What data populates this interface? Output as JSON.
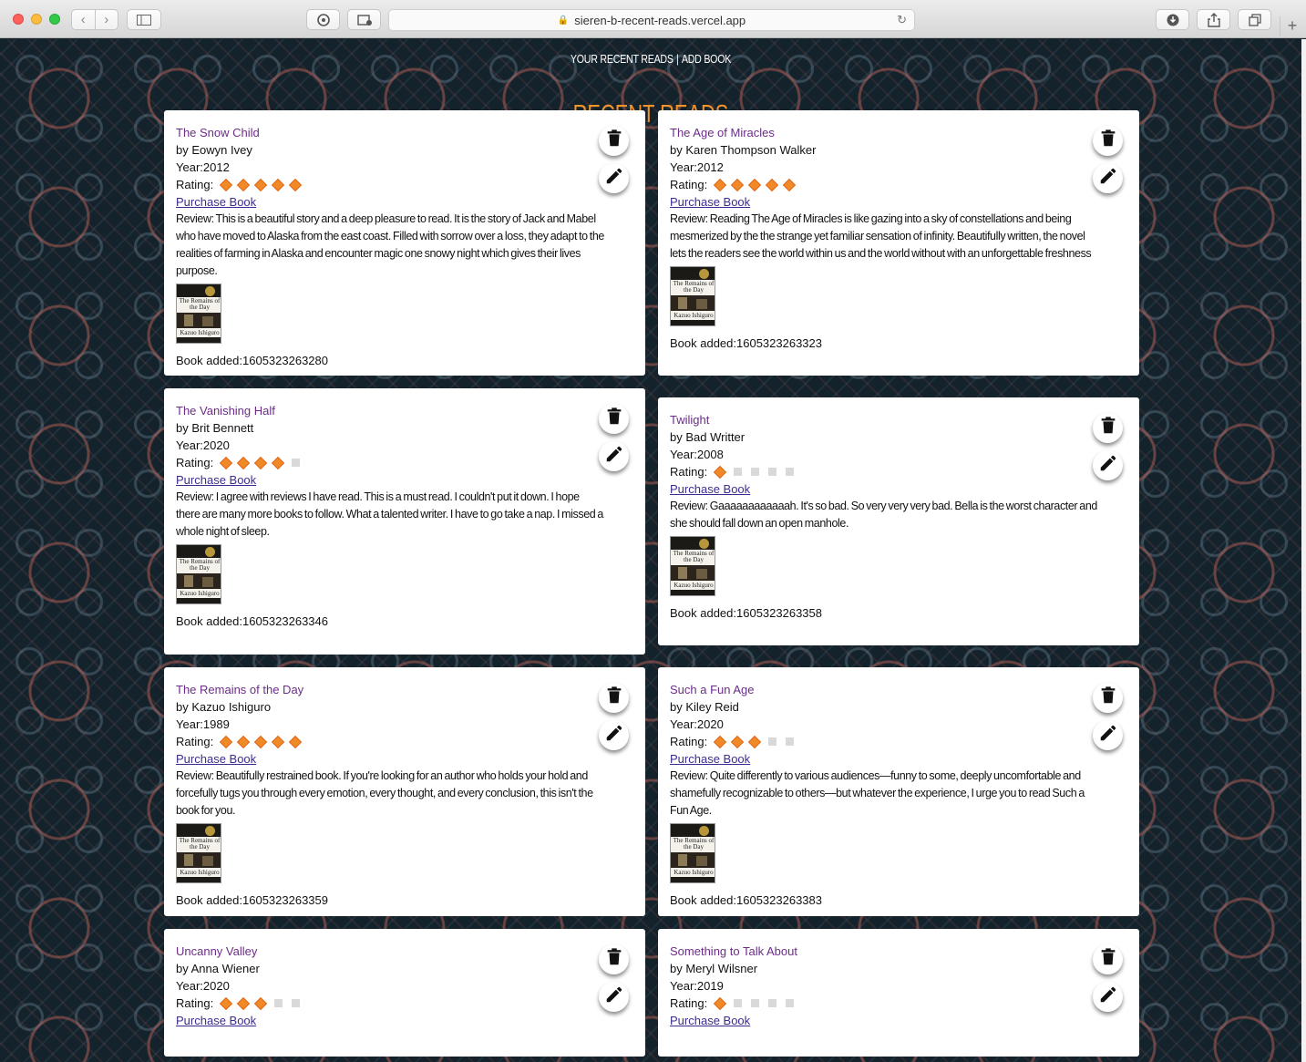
{
  "browser": {
    "url": "sieren-b-recent-reads.vercel.app"
  },
  "nav": {
    "recent_label": "YOUR RECENT READS",
    "separator": "|",
    "add_label": "ADD BOOK"
  },
  "page": {
    "title": "RECENT READS"
  },
  "labels": {
    "rating": "Rating:",
    "purchase": "Purchase Book"
  },
  "books": [
    {
      "title": "The Snow Child",
      "author": "by Eowyn Ivey",
      "year": "Year:2012",
      "rating": 5,
      "review": "Review: This is a beautiful story and a deep pleasure to read. It is the story of Jack and Mabel who have moved to Alaska from the east coast. Filled with sorrow over a loss, they adapt to the realities of farming in Alaska and encounter magic one snowy night which gives their lives purpose.",
      "added": "Book added:1605323263280"
    },
    {
      "title": "The Age of Miracles",
      "author": "by Karen Thompson Walker",
      "year": "Year:2012",
      "rating": 5,
      "review": "Review: Reading The Age of Miracles is like gazing into a sky of constellations and being mesmerized by the the strange yet familiar sensation of infinity. Beautifully written, the novel lets the readers see the world within us and the world without with an unforgettable freshness",
      "added": "Book added:1605323263323"
    },
    {
      "title": "The Vanishing Half",
      "author": "by Brit Bennett",
      "year": "Year:2020",
      "rating": 4,
      "review": "Review: I agree with reviews I have read. This is a must read. I couldn't put it down. I hope there are many more books to follow. What a talented writer. I have to go take a nap. I missed a whole night of sleep.",
      "added": "Book added:1605323263346"
    },
    {
      "title": "Twilight",
      "author": "by Bad Writter",
      "year": "Year:2008",
      "rating": 1,
      "review": "Review: Gaaaaaaaaaaaah. It's so bad. So very very very bad. Bella is the worst character and she should fall down an open manhole.",
      "added": "Book added:1605323263358"
    },
    {
      "title": "The Remains of the Day",
      "author": "by Kazuo Ishiguro",
      "year": "Year:1989",
      "rating": 5,
      "review": "Review: Beautifully restrained book. If you're looking for an author who holds your hold and forcefully tugs you through every emotion, every thought, and every conclusion, this isn't the book for you.",
      "added": "Book added:1605323263359"
    },
    {
      "title": "Such a Fun Age",
      "author": "by Kiley Reid",
      "year": "Year:2020",
      "rating": 3,
      "review": "Review: Quite differently to various audiences—funny to some, deeply uncomfortable and shamefully recognizable to others—but whatever the experience, I urge you to read Such a Fun Age.",
      "added": "Book added:1605323263383"
    },
    {
      "title": "Uncanny Valley",
      "author": "by Anna Wiener",
      "year": "Year:2020",
      "rating": 3,
      "review": "",
      "added": ""
    },
    {
      "title": "Something to Talk About",
      "author": "by Meryl Wilsner",
      "year": "Year:2019",
      "rating": 1,
      "review": "",
      "added": ""
    }
  ],
  "cover": {
    "title_line": "The Remains of the Day",
    "author_line": "Kazuo Ishiguro"
  },
  "colors": {
    "accent": "#f3942b",
    "title_link": "#6c2c89",
    "background": "#13222b"
  },
  "icons": {
    "delete": "trash-icon",
    "edit": "pencil-icon",
    "rating_on": "diamond-icon",
    "rating_off": "square-icon"
  }
}
